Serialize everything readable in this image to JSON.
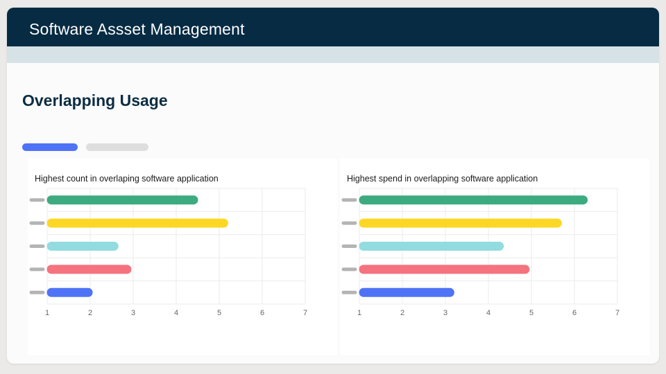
{
  "header": {
    "title": "Software Assset Management"
  },
  "page": {
    "title": "Overlapping Usage"
  },
  "tabs": [
    {
      "color": "#4f73f6",
      "active": true
    },
    {
      "color": "#dedede",
      "active": false
    }
  ],
  "chart_data": [
    {
      "type": "bar",
      "orientation": "horizontal",
      "title": "Highest count in overlaping software application",
      "xlabel": "",
      "ylabel": "",
      "xlim": [
        1,
        7
      ],
      "x_ticks": [
        "1",
        "2",
        "3",
        "4",
        "5",
        "6",
        "7"
      ],
      "grid": true,
      "values": [
        4.5,
        5.2,
        2.65,
        2.95,
        2.05
      ],
      "colors": [
        "#3dab80",
        "#fcd824",
        "#92dce0",
        "#f5727f",
        "#4f73f6"
      ]
    },
    {
      "type": "bar",
      "orientation": "horizontal",
      "title": "Highest spend in overlapping software application",
      "xlabel": "",
      "ylabel": "",
      "xlim": [
        1,
        7
      ],
      "x_ticks": [
        "1",
        "2",
        "3",
        "4",
        "5",
        "6",
        "7"
      ],
      "grid": true,
      "values": [
        6.3,
        5.7,
        4.35,
        4.95,
        3.2
      ],
      "colors": [
        "#3dab80",
        "#fcd824",
        "#92dce0",
        "#f5727f",
        "#4f73f6"
      ]
    }
  ]
}
